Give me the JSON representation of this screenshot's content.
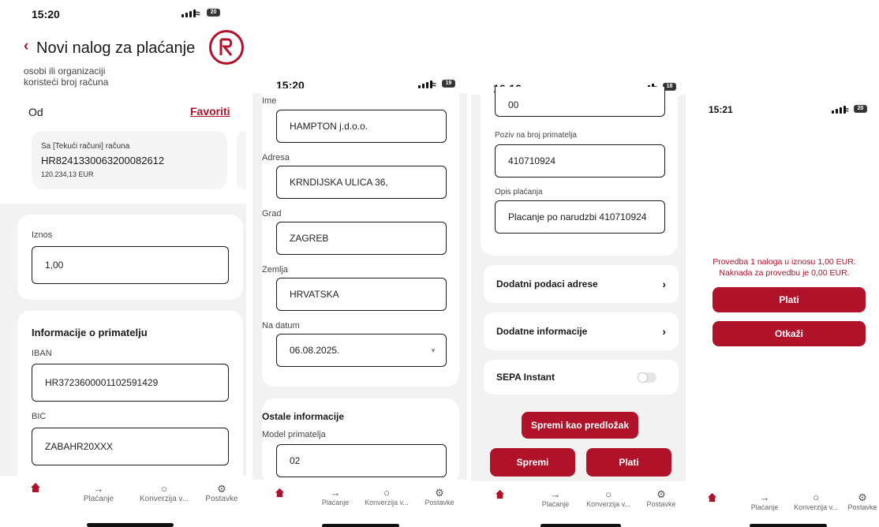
{
  "screens": [
    {
      "time": "15:20",
      "battery": "20",
      "title": "Novi nalog za plaćanje",
      "subtitle_line1": "osobi ili organizaciji",
      "subtitle_line2": "koristeći broj računa",
      "from_label": "Od",
      "favorites": "Favoriti",
      "account_name": "Sa [Tekući računi] računa",
      "account_iban": "HR8241330063200082612",
      "account_balance": "120.234,13 EUR",
      "amount_label": "Iznos",
      "amount_value": "1,00",
      "recipient_heading": "Informacije o primatelju",
      "iban_label": "IBAN",
      "iban_value": "HR3723600001102591429",
      "bic_label": "BIC",
      "bic_value": "ZABAHR20XXX",
      "tabs": [
        "Plaćanje",
        "Konverzija v...",
        "Postavke"
      ]
    },
    {
      "time": "15:20",
      "battery": "19",
      "name_label": "Ime",
      "name_value": "HAMPTON j.d.o.o.",
      "address_label": "Adresa",
      "address_value": "KRNDIJSKA ULICA 36,",
      "city_label": "Grad",
      "city_value": "ZAGREB",
      "country_label": "Zemlja",
      "country_value": "HRVATSKA",
      "date_label": "Na datum",
      "date_value": "06.08.2025.",
      "other_heading": "Ostale informacije",
      "model_label": "Model primatelja",
      "model_value": "02",
      "tabs": [
        "Plaćanje",
        "Konverzija v...",
        "Postavke"
      ]
    },
    {
      "time": "16:16",
      "battery": "18",
      "top_value": "00",
      "ref_label": "Poziv na broj primatelja",
      "ref_value": "410710924",
      "desc_label": "Opis plaćanja",
      "desc_value": "Placanje po narudzbi 410710924",
      "row_address": "Dodatni podaci adrese",
      "row_info": "Dodatne informacije",
      "row_sepa": "SEPA Instant",
      "save_template": "Spremi kao predložak",
      "save": "Spremi",
      "pay": "Plati",
      "tabs": [
        "Plaćanje",
        "Konverzija v...",
        "Postavke"
      ]
    },
    {
      "time": "15:21",
      "battery": "20",
      "message_line1": "Provedba 1 naloga u iznosu 1,00 EUR.",
      "message_line2": "Naknada za provedbu je 0,00 EUR.",
      "pay": "Plati",
      "cancel": "Otkaži",
      "tabs": [
        "Plaćanje",
        "Konverzija v...",
        "Postavke"
      ]
    }
  ],
  "colors": {
    "brand_red": "#b0122a",
    "text": "#1a1a1a",
    "muted": "#666666"
  },
  "icons": {
    "home": "home-icon",
    "payment": "arrow-right-icon",
    "conversion": "circle-icon",
    "settings": "gear-icon"
  }
}
